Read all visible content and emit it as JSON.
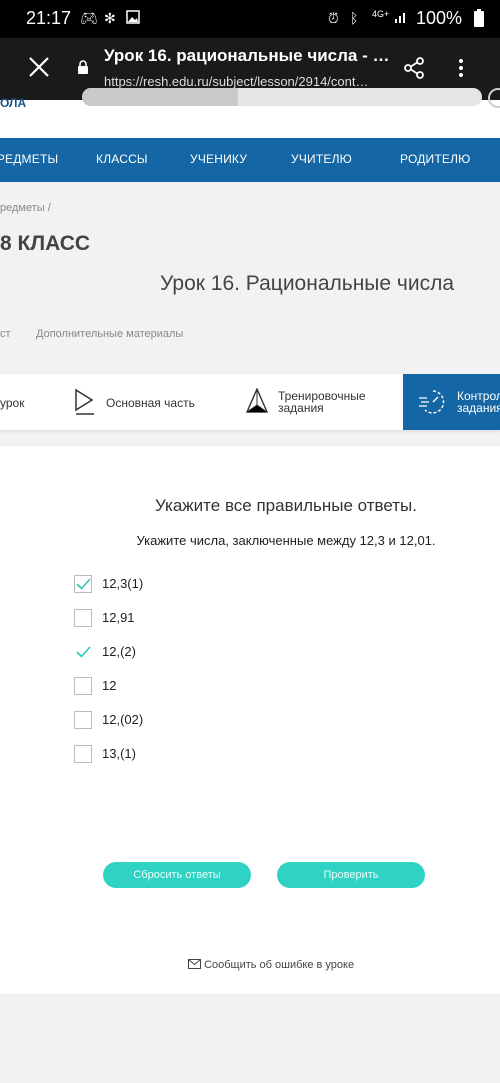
{
  "status_bar": {
    "time": "21:17",
    "network": "4G+",
    "battery": "100%",
    "icons": [
      "gamepad-icon",
      "pinwheel-icon",
      "image-icon",
      "alarm-icon",
      "bluetooth-icon",
      "signal-icon",
      "battery-icon"
    ]
  },
  "browser": {
    "page_title": "Урок 16. рациональные числа - …",
    "url": "https://resh.edu.ru/subject/lesson/2914/cont…"
  },
  "site": {
    "logo_fragment": "ОЛА",
    "nav": [
      "ПРЕДМЕТЫ",
      "КЛАССЫ",
      "УЧЕНИКУ",
      "УЧИТЕЛЮ",
      "РОДИТЕЛЮ"
    ],
    "breadcrumb": "редметы  /",
    "grade": "8 КЛАСС",
    "lesson_title": "Урок 16. Рациональные числа",
    "subtabs": [
      "ст",
      "Дополнительные материалы"
    ],
    "lesson_tabs": [
      {
        "label": "урок"
      },
      {
        "label": "Основная часть"
      },
      {
        "label_line1": "Тренировочные",
        "label_line2": "задания"
      },
      {
        "label_line1": "Контрол",
        "label_line2": "задания"
      }
    ]
  },
  "question": {
    "title": "Укажите все правильные ответы.",
    "prompt": "Укажите числа, заключенные между 12,3 и 12,01.",
    "options": [
      {
        "label": "12,3(1)",
        "checked": true,
        "bordered": true
      },
      {
        "label": "12,91",
        "checked": false,
        "bordered": true
      },
      {
        "label": "12,(2)",
        "checked": true,
        "bordered": false
      },
      {
        "label": "12",
        "checked": false,
        "bordered": true
      },
      {
        "label": "12,(02)",
        "checked": false,
        "bordered": true
      },
      {
        "label": "13,(1)",
        "checked": false,
        "bordered": true
      }
    ],
    "reset_label": "Сбросить ответы",
    "check_label": "Проверить",
    "report_label": "Сообщить об ошибке в уроке"
  },
  "colors": {
    "nav_blue": "#1467a4",
    "accent_teal": "#2fd3c3",
    "check": "#2fc6b4"
  }
}
